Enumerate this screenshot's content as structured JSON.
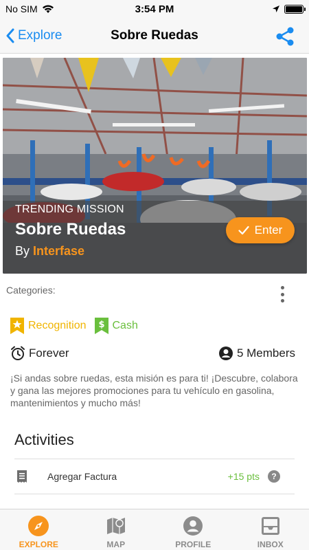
{
  "status_bar": {
    "carrier": "No SIM",
    "time": "3:54 PM"
  },
  "nav": {
    "back_label": "Explore",
    "title": "Sobre Ruedas"
  },
  "hero": {
    "kicker": "TRENDING MISSION",
    "title": "Sobre Ruedas",
    "by_prefix": "By",
    "author": "Interfase",
    "enter_label": "Enter"
  },
  "details": {
    "categories_label": "Categories:",
    "tags": [
      {
        "label": "Recognition",
        "icon": "star-badge-icon",
        "color": "#f0b400"
      },
      {
        "label": "Cash",
        "icon": "dollar-badge-icon",
        "color": "#6abf3d"
      }
    ],
    "duration": "Forever",
    "members": "5 Members",
    "description": "¡Si andas sobre ruedas, esta misión es para ti! ¡Descubre, colabora y gana las mejores promociones para tu vehículo en gasolina, mantenimientos y mucho más!"
  },
  "activities": {
    "title": "Activities",
    "items": [
      {
        "label": "Agregar Factura",
        "points": "+15 pts",
        "icon": "receipt-icon"
      }
    ]
  },
  "tabs": [
    {
      "label": "EXPLORE",
      "icon": "compass-icon",
      "active": true
    },
    {
      "label": "MAP",
      "icon": "map-icon",
      "active": false
    },
    {
      "label": "PROFILE",
      "icon": "profile-icon",
      "active": false
    },
    {
      "label": "INBOX",
      "icon": "inbox-icon",
      "active": false
    }
  ],
  "colors": {
    "accent": "#f7941d",
    "link": "#1a8cf0",
    "points": "#6abf3d",
    "recognition": "#f0b400"
  }
}
